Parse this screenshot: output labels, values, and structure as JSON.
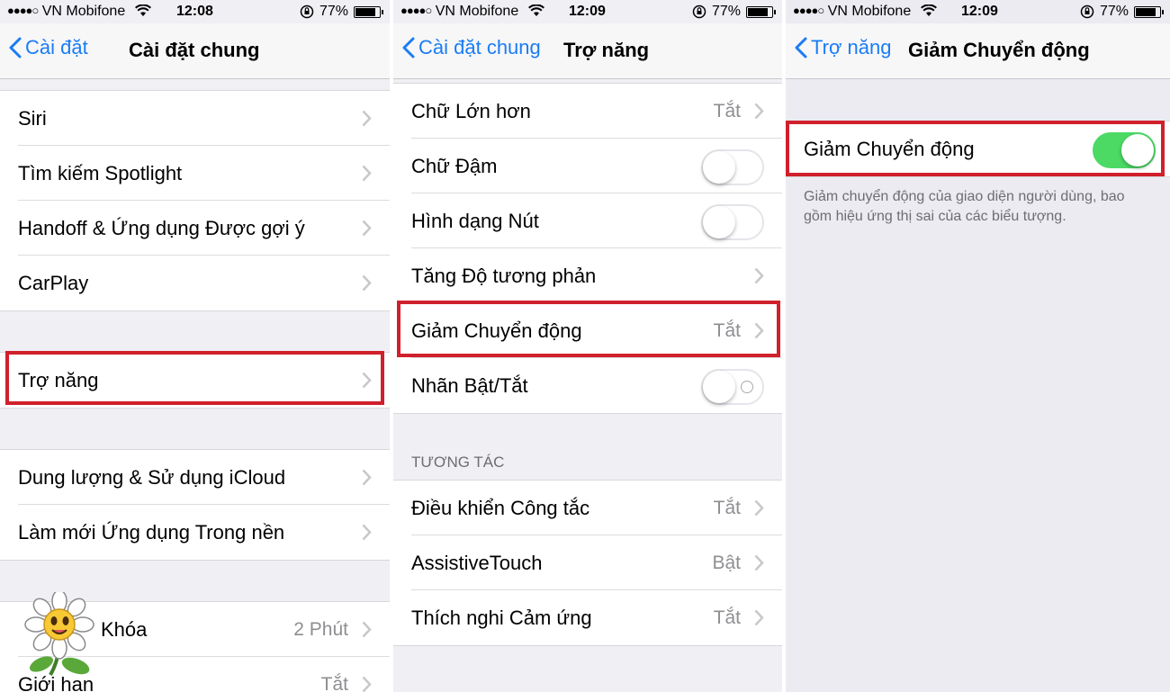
{
  "status_bar": [
    {
      "carrier": "VN Mobifone",
      "signal": "●●●●○",
      "time": "12:08",
      "battery": "77%",
      "battery_level": 0.77
    },
    {
      "carrier": "VN Mobifone",
      "signal": "●●●●○",
      "time": "12:09",
      "battery": "77%",
      "battery_level": 0.77
    },
    {
      "carrier": "VN Mobifone",
      "signal": "●●●●○",
      "time": "12:09",
      "battery": "77%",
      "battery_level": 0.77
    }
  ],
  "panel1": {
    "back_label": "Cài đặt",
    "title": "Cài đặt chung",
    "group1": [
      {
        "label": "Siri"
      },
      {
        "label": "Tìm kiếm Spotlight"
      },
      {
        "label": "Handoff & Ứng dụng Được gợi ý"
      },
      {
        "label": "CarPlay"
      }
    ],
    "group2": [
      {
        "label": "Trợ năng"
      }
    ],
    "group3": [
      {
        "label": "Dung lượng & Sử dụng iCloud"
      },
      {
        "label": "Làm mới Ứng dụng Trong nền"
      }
    ],
    "group4": [
      {
        "label": "Khóa",
        "value": "2 Phút"
      },
      {
        "label": "Giới hạn",
        "value": "Tắt"
      }
    ]
  },
  "panel2": {
    "back_label": "Cài đặt chung",
    "title": "Trợ năng",
    "group1": [
      {
        "label": "Chữ Lớn hơn",
        "value": "Tắt"
      },
      {
        "label": "Chữ Đậm",
        "toggle": false
      },
      {
        "label": "Hình dạng Nút",
        "toggle": false
      },
      {
        "label": "Tăng Độ tương phản"
      },
      {
        "label": "Giảm Chuyển động",
        "value": "Tắt"
      },
      {
        "label": "Nhãn Bật/Tắt",
        "toggle": false
      }
    ],
    "section_header": "TƯƠNG TÁC",
    "group2": [
      {
        "label": "Điều khiển Công tắc",
        "value": "Tắt"
      },
      {
        "label": "AssistiveTouch",
        "value": "Bật"
      },
      {
        "label": "Thích nghi Cảm ứng",
        "value": "Tắt"
      }
    ]
  },
  "panel3": {
    "back_label": "Trợ năng",
    "title": "Giảm Chuyển động",
    "row_label": "Giảm Chuyển động",
    "toggle_on": true,
    "footer": "Giảm chuyển động của giao diện người dùng, bao gồm hiệu ứng thị sai của các biểu tượng."
  },
  "colors": {
    "accent": "#1a7cf5",
    "highlight": "#d0202c",
    "toggle_on": "#4cd964"
  }
}
